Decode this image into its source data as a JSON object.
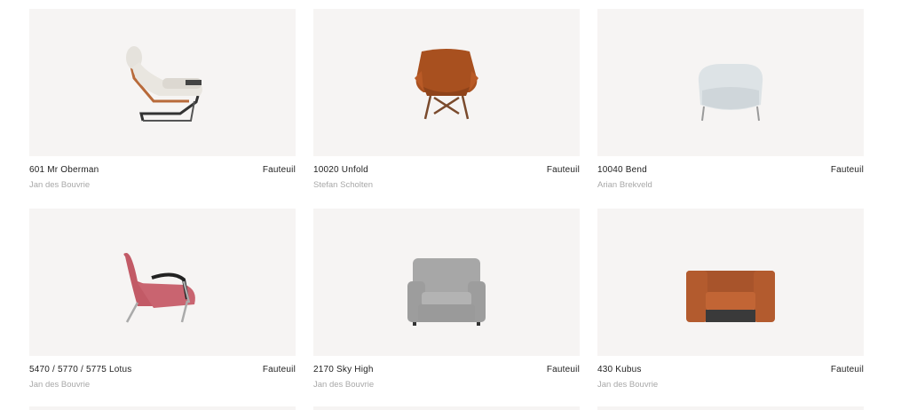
{
  "products": [
    {
      "name": "601 Mr Oberman",
      "type": "Fauteuil",
      "designer": "Jan des Bouvrie",
      "image_icon": "lounge-chair-cream-icon"
    },
    {
      "name": "10020 Unfold",
      "type": "Fauteuil",
      "designer": "Stefan Scholten",
      "image_icon": "rust-wing-chair-icon"
    },
    {
      "name": "10040 Bend",
      "type": "Fauteuil",
      "designer": "Arian Brekveld",
      "image_icon": "light-blue-tub-chair-icon"
    },
    {
      "name": "5470 / 5770 / 5775 Lotus",
      "type": "Fauteuil",
      "designer": "Jan des Bouvrie",
      "image_icon": "pink-lotus-chair-icon"
    },
    {
      "name": "2170 Sky High",
      "type": "Fauteuil",
      "designer": "Jan des Bouvrie",
      "image_icon": "grey-wingback-armchair-icon"
    },
    {
      "name": "430 Kubus",
      "type": "Fauteuil",
      "designer": "Jan des Bouvrie",
      "image_icon": "cognac-cube-armchair-icon"
    }
  ],
  "colors": {
    "image_background": "#f6f4f3",
    "title_text": "#222222",
    "designer_text": "#a8a8a8"
  }
}
